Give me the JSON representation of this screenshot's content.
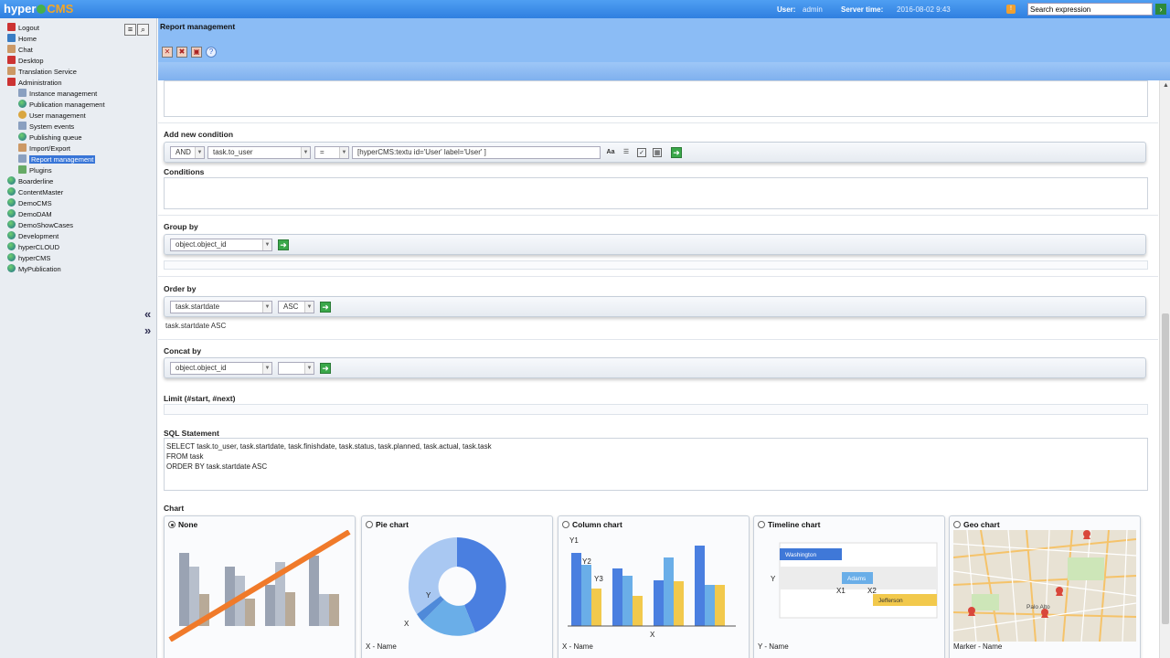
{
  "topbar": {
    "logo_text": "hyper",
    "logo_accent": "CMS",
    "user_label": "User:",
    "user_value": "admin",
    "time_label": "Server time:",
    "time_value": "2016-08-02 9:43",
    "search_placeholder": "Search expression"
  },
  "sidebar": {
    "items": [
      {
        "label": "Logout"
      },
      {
        "label": "Home"
      },
      {
        "label": "Chat"
      },
      {
        "label": "Desktop"
      },
      {
        "label": "Translation Service"
      },
      {
        "label": "Administration"
      },
      {
        "label": "Instance management"
      },
      {
        "label": "Publication management"
      },
      {
        "label": "User management"
      },
      {
        "label": "System events"
      },
      {
        "label": "Publishing queue"
      },
      {
        "label": "Import/Export"
      },
      {
        "label": "Report management"
      },
      {
        "label": "Plugins"
      },
      {
        "label": "Boarderline"
      },
      {
        "label": "ContentMaster"
      },
      {
        "label": "DemoCMS"
      },
      {
        "label": "DemoDAM"
      },
      {
        "label": "DemoShowCases"
      },
      {
        "label": "Development"
      },
      {
        "label": "hyperCLOUD"
      },
      {
        "label": "hyperCMS"
      },
      {
        "label": "MyPublication"
      }
    ]
  },
  "header": {
    "title": "Report management"
  },
  "add_condition": {
    "label": "Add new condition",
    "logic": "AND",
    "field": "task.to_user",
    "operator": "=",
    "value": "[hyperCMS:textu id='User' label='User' ]"
  },
  "conditions": {
    "label": "Conditions"
  },
  "group_by": {
    "label": "Group by",
    "field": "object.object_id"
  },
  "order_by": {
    "label": "Order by",
    "field": "task.startdate",
    "direction": "ASC",
    "current": "task.startdate ASC"
  },
  "concat_by": {
    "label": "Concat by",
    "field": "object.object_id",
    "second": ""
  },
  "limit": {
    "label": "Limit (#start, #next)"
  },
  "sql": {
    "label": "SQL Statement",
    "text": "SELECT task.to_user, task.startdate, task.finishdate, task.status, task.planned, task.actual, task.task\nFROM task\nORDER BY task.startdate ASC"
  },
  "chart": {
    "label": "Chart",
    "options": [
      {
        "title": "None",
        "selected": true,
        "field_label": ""
      },
      {
        "title": "Pie chart",
        "selected": false,
        "field_label": "X - Name"
      },
      {
        "title": "Column chart",
        "selected": false,
        "field_label": "X - Name"
      },
      {
        "title": "Timeline chart",
        "selected": false,
        "field_label": "Y - Name"
      },
      {
        "title": "Geo chart",
        "selected": false,
        "field_label": "Marker - Name"
      }
    ],
    "pie_labels": {
      "x": "X",
      "y": "Y"
    },
    "column_labels": {
      "y1": "Y1",
      "y2": "Y2",
      "y3": "Y3",
      "x": "X"
    },
    "timeline_labels": {
      "row1": "Washington",
      "row2": "Adams",
      "row3": "Jefferson",
      "y": "Y",
      "x1": "X1",
      "x2": "X2"
    },
    "geo_labels": {
      "city": "Palo Alto"
    }
  },
  "colors": {
    "topbar": "#2f7fe0",
    "header": "#8bbcf5",
    "accent_orange": "#f07a2a",
    "chart_blue": "#4a7fe0",
    "chart_lightblue": "#6aaee8",
    "chart_yellow": "#f2c94c"
  }
}
